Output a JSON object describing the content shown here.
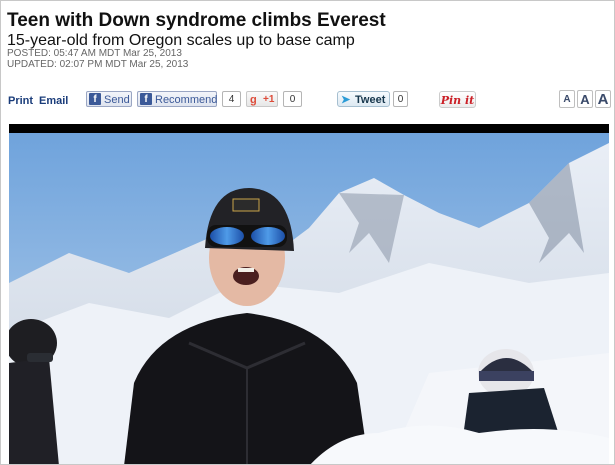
{
  "article": {
    "headline": "Teen with Down syndrome climbs Everest",
    "subheadline": "15-year-old from Oregon scales up to base camp",
    "posted": "POSTED: 05:47 AM MDT Mar 25, 2013",
    "updated": "UPDATED: 02:07 PM MDT Mar 25, 2013"
  },
  "toolbar": {
    "print": "Print",
    "email": "Email",
    "fb_send": "Send",
    "fb_recommend": "Recommend",
    "fb_count": "4",
    "gplus_label": "+1",
    "gplus_count": "0",
    "tweet": "Tweet",
    "tweet_count": "0",
    "pinit": "Pin it",
    "font_small": "A",
    "font_medium": "A",
    "font_large": "A"
  },
  "icons": {
    "facebook": "facebook-icon",
    "gplus": "google-plus-icon",
    "twitter": "twitter-bird-icon",
    "pinterest": "pinterest-icon"
  },
  "colors": {
    "link": "#1a3c7a",
    "facebook": "#3b5998",
    "gplus": "#dd4b39",
    "twitter": "#2a9bd6",
    "pinterest": "#cb2027"
  }
}
